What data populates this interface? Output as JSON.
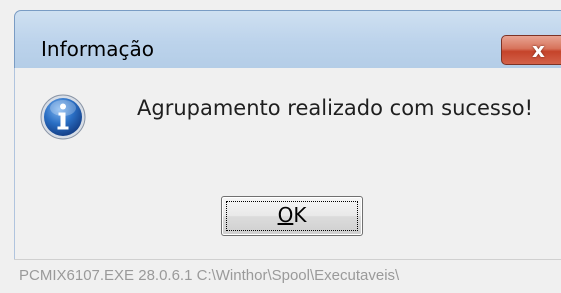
{
  "dialog": {
    "title": "Informação",
    "close_label": "x",
    "message": "Agrupamento realizado com sucesso!",
    "icon": "info-icon",
    "ok_button": {
      "mnemonic": "O",
      "rest": "K"
    }
  },
  "status_bar": {
    "text": "PCMIX6107.EXE 28.0.6.1 C:\\Winthor\\Spool\\Executaveis\\"
  },
  "colors": {
    "title_bar": "#bcd3eb",
    "close_button": "#c5432a",
    "info_icon_blue": "#1c5fae",
    "background": "#f0f0f0",
    "status_text": "#9a9a9a"
  }
}
